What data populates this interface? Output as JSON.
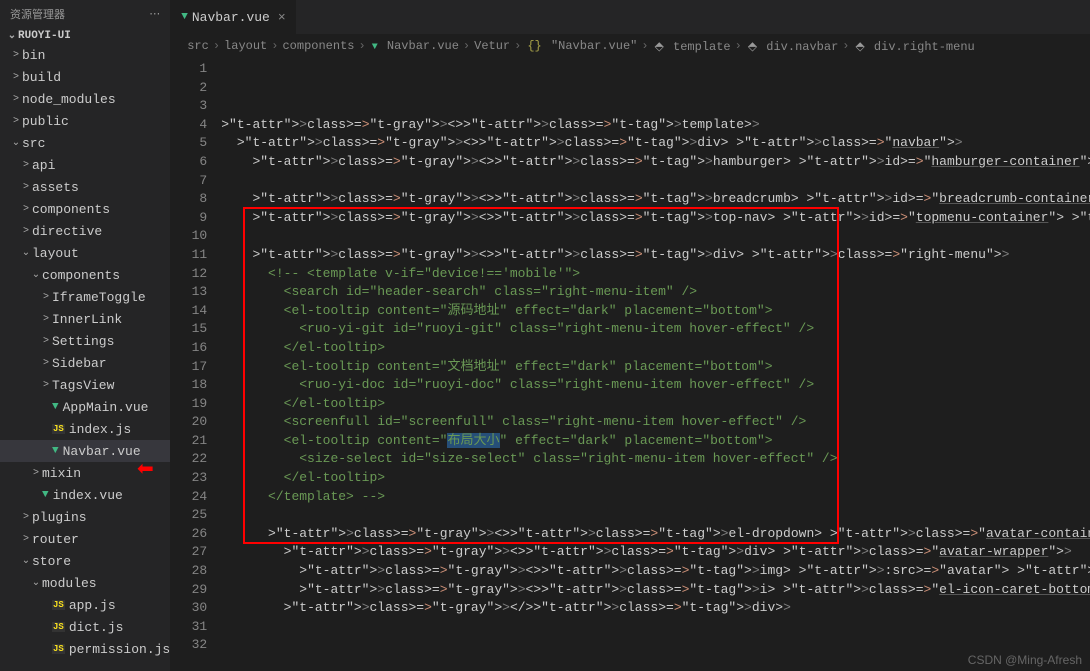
{
  "sidebar": {
    "title": "资源管理器",
    "project": "RUOYI-UI",
    "items": [
      {
        "label": "bin",
        "type": "folder",
        "chev": ">",
        "indent": 1
      },
      {
        "label": "build",
        "type": "folder",
        "chev": ">",
        "indent": 1
      },
      {
        "label": "node_modules",
        "type": "folder",
        "chev": ">",
        "indent": 1
      },
      {
        "label": "public",
        "type": "folder",
        "chev": ">",
        "indent": 1
      },
      {
        "label": "src",
        "type": "folder",
        "chev": "⌄",
        "indent": 1
      },
      {
        "label": "api",
        "type": "folder",
        "chev": ">",
        "indent": 2
      },
      {
        "label": "assets",
        "type": "folder",
        "chev": ">",
        "indent": 2
      },
      {
        "label": "components",
        "type": "folder",
        "chev": ">",
        "indent": 2
      },
      {
        "label": "directive",
        "type": "folder",
        "chev": ">",
        "indent": 2
      },
      {
        "label": "layout",
        "type": "folder",
        "chev": "⌄",
        "indent": 2
      },
      {
        "label": "components",
        "type": "folder",
        "chev": "⌄",
        "indent": 3
      },
      {
        "label": "IframeToggle",
        "type": "folder",
        "chev": ">",
        "indent": 4
      },
      {
        "label": "InnerLink",
        "type": "folder",
        "chev": ">",
        "indent": 4
      },
      {
        "label": "Settings",
        "type": "folder",
        "chev": ">",
        "indent": 4
      },
      {
        "label": "Sidebar",
        "type": "folder",
        "chev": ">",
        "indent": 4
      },
      {
        "label": "TagsView",
        "type": "folder",
        "chev": ">",
        "indent": 4
      },
      {
        "label": "AppMain.vue",
        "type": "vue",
        "chev": "",
        "indent": 4
      },
      {
        "label": "index.js",
        "type": "js",
        "chev": "",
        "indent": 4
      },
      {
        "label": "Navbar.vue",
        "type": "vue",
        "chev": "",
        "indent": 4,
        "active": true
      },
      {
        "label": "mixin",
        "type": "folder",
        "chev": ">",
        "indent": 3
      },
      {
        "label": "index.vue",
        "type": "vue",
        "chev": "",
        "indent": 3
      },
      {
        "label": "plugins",
        "type": "folder",
        "chev": ">",
        "indent": 2
      },
      {
        "label": "router",
        "type": "folder",
        "chev": ">",
        "indent": 2
      },
      {
        "label": "store",
        "type": "folder",
        "chev": "⌄",
        "indent": 2
      },
      {
        "label": "modules",
        "type": "folder",
        "chev": "⌄",
        "indent": 3
      },
      {
        "label": "app.js",
        "type": "js",
        "chev": "",
        "indent": 4
      },
      {
        "label": "dict.js",
        "type": "js",
        "chev": "",
        "indent": 4
      },
      {
        "label": "permission.js",
        "type": "js",
        "chev": "",
        "indent": 4
      }
    ]
  },
  "tab": {
    "label": "Navbar.vue"
  },
  "breadcrumb": {
    "parts": [
      "src",
      "layout",
      "components",
      "Navbar.vue",
      "Vetur",
      "\"Navbar.vue\"",
      "template",
      "div.navbar",
      "div.right-menu"
    ]
  },
  "code": {
    "lines": [
      "<template>",
      "  <div class=\"navbar\">",
      "    <hamburger id=\"hamburger-container\" :is-active=\"sidebar.opened\" class=\"hamburger-container\" @toggleClick=\"to",
      "",
      "    <breadcrumb id=\"breadcrumb-container\" class=\"breadcrumb-container\" v-if=\"!topNav\"/>",
      "    <top-nav id=\"topmenu-container\" class=\"topmenu-container\" v-if=\"topNav\"/>",
      "",
      "    <div class=\"right-menu\">",
      "      <!-- <template v-if=\"device!=='mobile'\">",
      "        <search id=\"header-search\" class=\"right-menu-item\" />",
      "",
      "        <el-tooltip content=\"源码地址\" effect=\"dark\" placement=\"bottom\">",
      "          <ruo-yi-git id=\"ruoyi-git\" class=\"right-menu-item hover-effect\" />",
      "        </el-tooltip>",
      "",
      "        <el-tooltip content=\"文档地址\" effect=\"dark\" placement=\"bottom\">",
      "          <ruo-yi-doc id=\"ruoyi-doc\" class=\"right-menu-item hover-effect\" />",
      "        </el-tooltip>",
      "",
      "        <screenfull id=\"screenfull\" class=\"right-menu-item hover-effect\" />",
      "",
      "        <el-tooltip content=\"布局大小\" effect=\"dark\" placement=\"bottom\">",
      "          <size-select id=\"size-select\" class=\"right-menu-item hover-effect\" />",
      "        </el-tooltip>",
      "",
      "      </template> -->",
      "",
      "      <el-dropdown class=\"avatar-container right-menu-item hover-effect\" trigger=\"click\">",
      "        <div class=\"avatar-wrapper\">",
      "          <img :src=\"avatar\" class=\"user-avatar\">",
      "          <i class=\"el-icon-caret-bottom\" />",
      "        </div>"
    ]
  },
  "watermark": "CSDN @Ming-Afresh"
}
